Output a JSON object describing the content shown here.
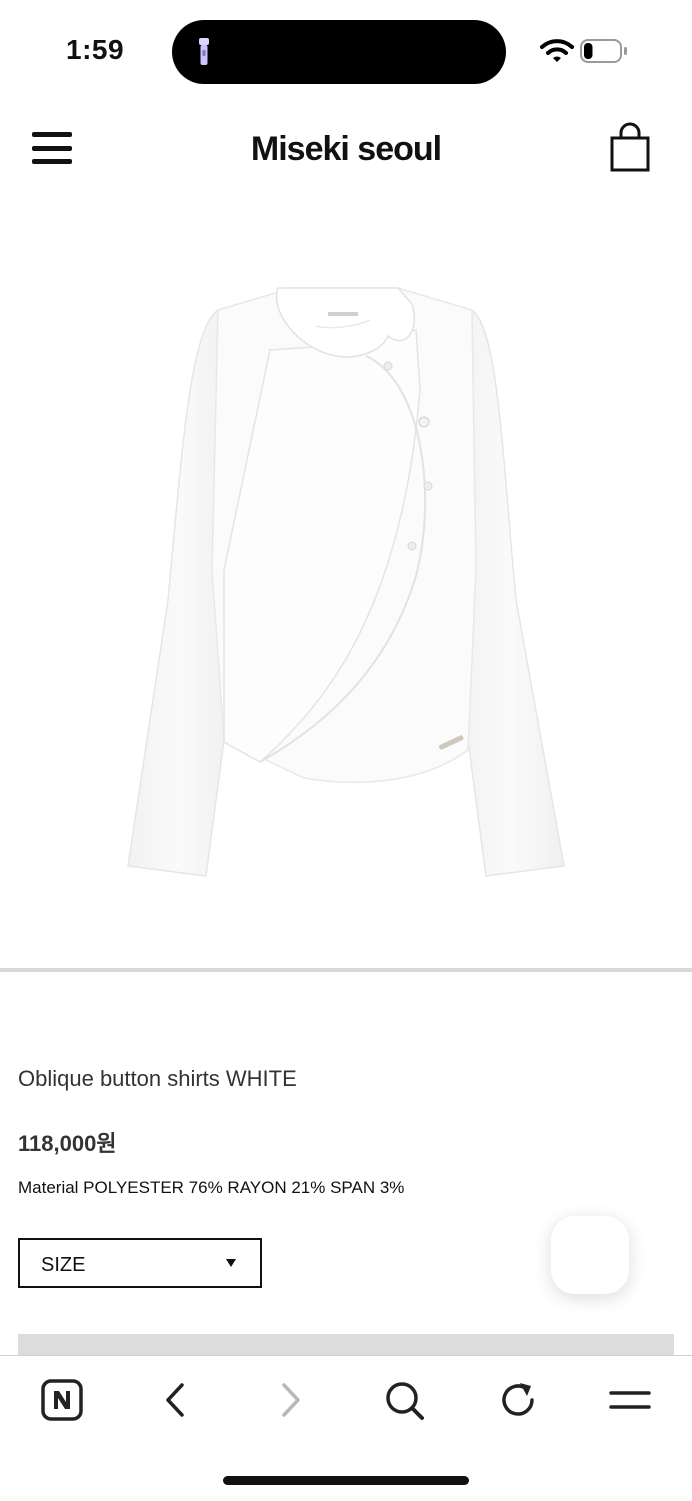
{
  "status_bar": {
    "time": "1:59",
    "battery_level": 0.25
  },
  "header": {
    "brand": "Miseki seoul",
    "menu_icon": "hamburger-menu-icon",
    "cart_icon": "shopping-bag-icon"
  },
  "product": {
    "image_icon": "white-oblique-button-shirt-image",
    "name": "Oblique button shirts WHITE",
    "price": "118,000원",
    "material": "Material POLYESTER 76% RAYON 21% SPAN 3%",
    "size_select": {
      "label": "SIZE",
      "options_visible": [
        "SIZE"
      ]
    }
  },
  "toolbar": {
    "items": [
      "naver-home-icon",
      "back-icon",
      "forward-icon",
      "search-icon",
      "reload-icon",
      "menu-icon"
    ],
    "forward_enabled": false
  },
  "colors": {
    "text": "#222222",
    "border": "#111111",
    "divider": "#d8d8d8",
    "disabled": "#b8b8b8"
  }
}
